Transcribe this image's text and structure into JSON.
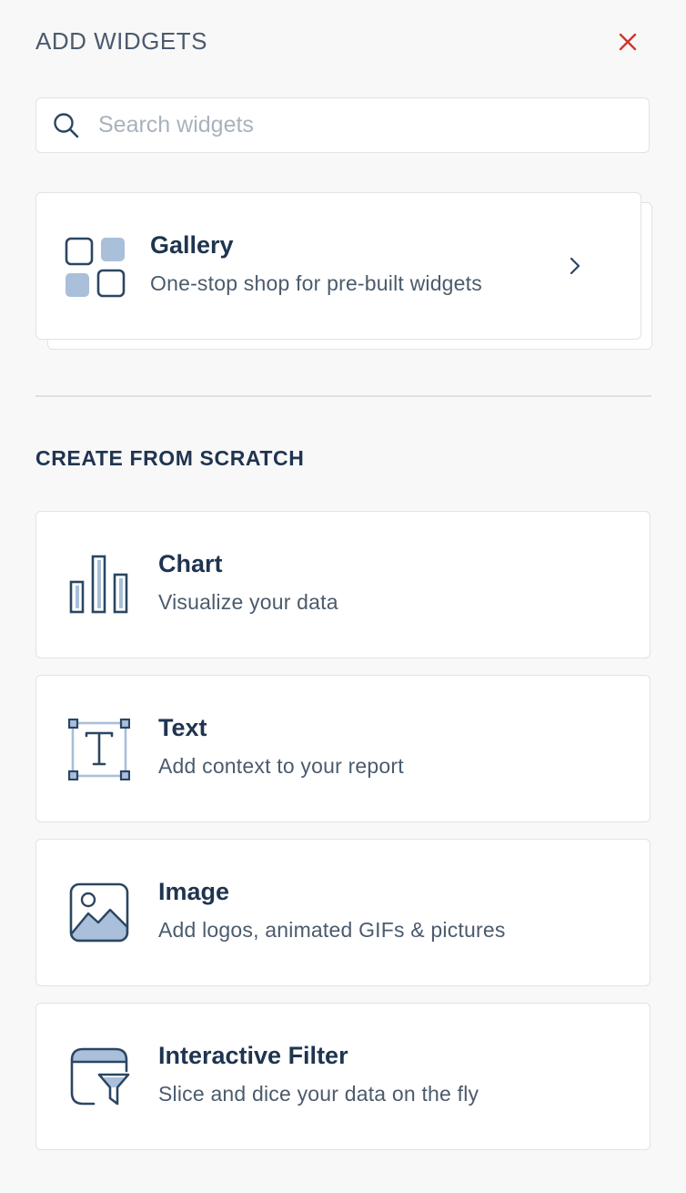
{
  "header": {
    "title": "ADD WIDGETS",
    "close_icon": "close-icon",
    "close_color": "#d0342c"
  },
  "search": {
    "placeholder": "Search widgets",
    "value": "",
    "icon": "search-icon"
  },
  "gallery": {
    "title": "Gallery",
    "description": "One-stop shop for pre-built widgets",
    "icon": "gallery-grid-icon"
  },
  "section": {
    "heading": "CREATE FROM SCRATCH"
  },
  "widgets": [
    {
      "title": "Chart",
      "description": "Visualize your data",
      "icon": "bar-chart-icon"
    },
    {
      "title": "Text",
      "description": "Add context to your report",
      "icon": "text-box-icon"
    },
    {
      "title": "Image",
      "description": "Add logos, animated GIFs & pictures",
      "icon": "image-icon"
    },
    {
      "title": "Interactive Filter",
      "description": "Slice and dice your data on the fly",
      "icon": "filter-icon"
    }
  ],
  "colors": {
    "text_primary": "#1f3450",
    "text_secondary": "#4b5b6d",
    "icon_fill": "#a9bfda",
    "icon_stroke": "#2b4662",
    "border": "#dfe3e8",
    "background": "#f8f8f8"
  }
}
